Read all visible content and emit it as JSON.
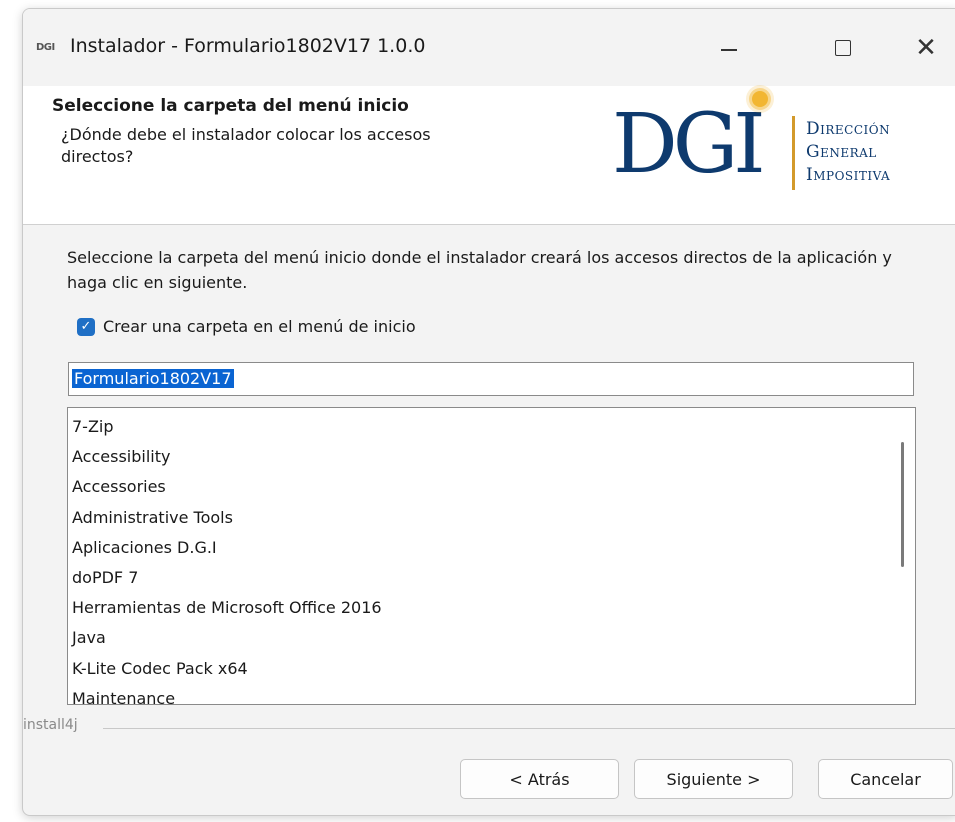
{
  "window": {
    "icon_text": "DGI",
    "title": "Instalador - Formulario1802V17 1.0.0",
    "controls": {
      "minimize": "—",
      "maximize": "☐",
      "close": "✕"
    }
  },
  "header": {
    "title": "Seleccione la carpeta del menú inicio",
    "subtitle": "¿Dónde debe el instalador colocar los accesos directos?",
    "logo": {
      "acronym": "DGI",
      "line1": "Dirección",
      "line2": "General",
      "line3": "Impositiva",
      "colors": {
        "primary": "#0e3a6e",
        "accent": "#d39a2b",
        "sun": "#f2b632"
      }
    }
  },
  "body": {
    "instructions": "Seleccione la carpeta del menú inicio donde el instalador creará los accesos directos de la aplicación y haga clic en siguiente.",
    "checkbox": {
      "label": "Crear una carpeta en el menú de inicio",
      "checked": true
    },
    "folder_input": {
      "value": "Formulario1802V17"
    },
    "folder_list": [
      "7-Zip",
      "Accessibility",
      "Accessories",
      "Administrative Tools",
      "Aplicaciones D.G.I",
      "doPDF 7",
      "Herramientas de Microsoft Office 2016",
      "Java",
      "K-Lite Codec Pack x64",
      "Maintenance"
    ]
  },
  "footer": {
    "brand": "install4j",
    "buttons": {
      "back": "< Atrás",
      "next": "Siguiente >",
      "cancel": "Cancelar"
    }
  }
}
